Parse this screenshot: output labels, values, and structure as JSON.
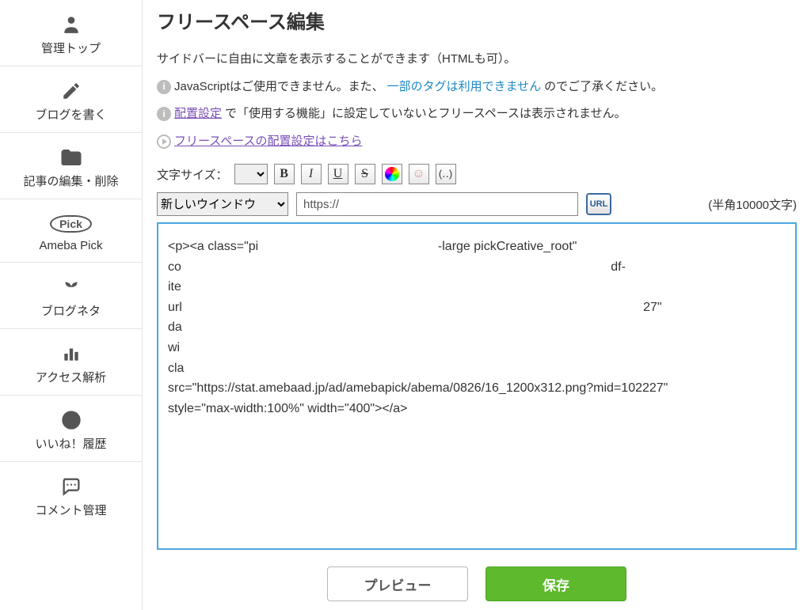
{
  "sidebar": {
    "items": [
      {
        "label": "管理トップ"
      },
      {
        "label": "ブログを書く"
      },
      {
        "label": "記事の編集・削除"
      },
      {
        "label": "Ameba Pick"
      },
      {
        "label": "ブログネタ"
      },
      {
        "label": "アクセス解析"
      },
      {
        "label": "いいね！履歴"
      },
      {
        "label": "コメント管理"
      }
    ]
  },
  "page": {
    "title": "フリースペース編集",
    "desc1": "サイドバーに自由に文章を表示することができます（HTMLも可）。",
    "desc2_pre": "JavaScriptはご使用できません。また、",
    "desc2_link": "一部のタグは利用できません",
    "desc2_post": "のでご了承ください。",
    "desc3_link": "配置設定",
    "desc3_post": "で「使用する機能」に設定していないとフリースペースは表示されません。",
    "desc4_link": "フリースペースの配置設定はこちら"
  },
  "toolbar": {
    "font_size_label": "文字サイズ：",
    "bold": "B",
    "italic": "I",
    "underline": "U",
    "strike": "S",
    "bracket": "(‥)"
  },
  "row2": {
    "window_select": "新しいウインドウ",
    "url_value": "https://",
    "url_btn": "URL",
    "char_count": "(半角10000文字)"
  },
  "editor": {
    "content": "<p><a class=\"pi                                                   -large pickCreative_root\"\nco                                                                                                                          df-\nite\nurl                                                                                                                                   27\"\nda\nwi\ncla\nsrc=\"https://stat.amebaad.jp/ad/amebapick/abema/0826/16_1200x312.png?mid=102227\"\nstyle=\"max-width:100%\" width=\"400\"></a>"
  },
  "buttons": {
    "preview": "プレビュー",
    "save": "保存"
  }
}
